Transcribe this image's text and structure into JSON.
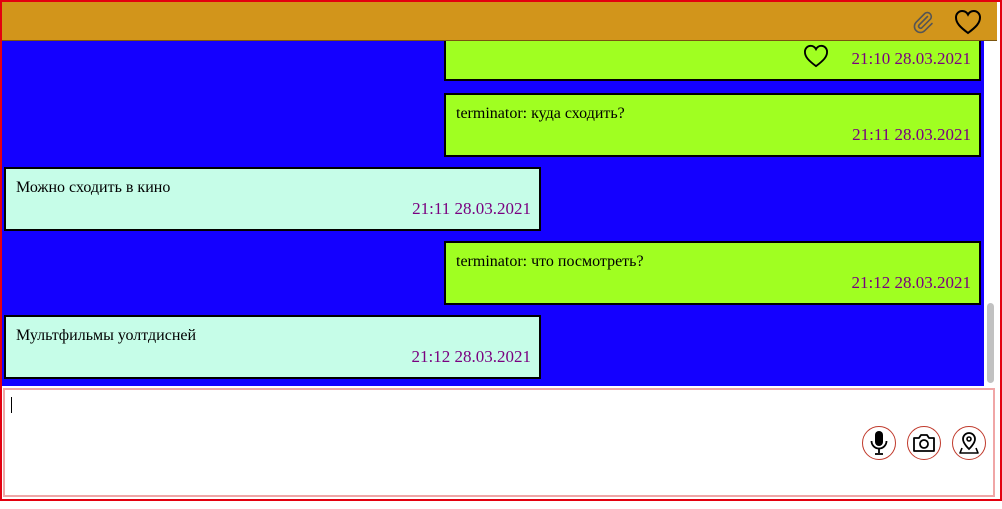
{
  "header": {
    "attach_icon": "paperclip-icon",
    "favorite_icon": "heart-icon"
  },
  "messages": [
    {
      "direction": "out",
      "text": "",
      "time": "21:10 28.03.2021",
      "liked_icon": "heart-icon"
    },
    {
      "direction": "out",
      "text": "terminator: куда сходить?",
      "time": "21:11 28.03.2021"
    },
    {
      "direction": "in",
      "text": "Можно сходить в кино",
      "time": "21:11 28.03.2021"
    },
    {
      "direction": "out",
      "text": "terminator: что посмотреть?",
      "time": "21:12 28.03.2021"
    },
    {
      "direction": "in",
      "text": "Мультфильмы уолтдисней",
      "time": "21:12 28.03.2021"
    }
  ],
  "composer": {
    "value": "",
    "buttons": [
      "microphone-icon",
      "camera-icon",
      "location-pin-icon"
    ]
  },
  "colors": {
    "header": "#d2951b",
    "chat_background": "#1400ff",
    "outgoing_bubble": "#a0ff21",
    "incoming_bubble": "#c6fde8",
    "timestamp": "#7a0080",
    "frame_border": "#e3000f"
  }
}
